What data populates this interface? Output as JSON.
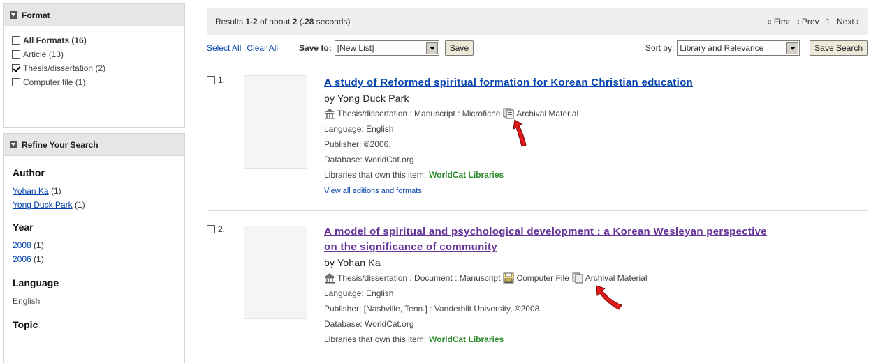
{
  "format_panel": {
    "title": "Format",
    "items": [
      {
        "label": "All Formats",
        "count": "(16)",
        "checked": false
      },
      {
        "label": "Article",
        "count": "(13)",
        "checked": false
      },
      {
        "label": "Thesis/dissertation",
        "count": "(2)",
        "checked": true
      },
      {
        "label": "Computer file",
        "count": "(1)",
        "checked": false
      }
    ]
  },
  "refine_panel": {
    "title": "Refine Your Search",
    "author": {
      "heading": "Author",
      "items": [
        {
          "label": "Yohan Ka",
          "count": "(1)"
        },
        {
          "label": "Yong Duck Park",
          "count": "(1)"
        }
      ]
    },
    "year": {
      "heading": "Year",
      "items": [
        {
          "label": "2008",
          "count": "(1)"
        },
        {
          "label": "2006",
          "count": "(1)"
        }
      ]
    },
    "language": {
      "heading": "Language",
      "value": "English"
    },
    "topic": {
      "heading": "Topic"
    }
  },
  "results_bar": {
    "prefix": "Results ",
    "range": "1-2",
    "middle": " of about ",
    "total": "2",
    "time_open": " (",
    "time": ".28",
    "time_close": " seconds)",
    "first": "« First",
    "prev": "‹ Prev",
    "page": "1",
    "next": "Next ›"
  },
  "toolbar": {
    "select_all": "Select All",
    "clear_all": "Clear All",
    "save_to_label": "Save to:",
    "save_to_value": "[New List]",
    "save_button": "Save",
    "sort_label": "Sort by:",
    "sort_value": "Library and Relevance",
    "save_search_button": "Save Search"
  },
  "results": [
    {
      "number": "1.",
      "title": "A study of Reformed spiritual formation for Korean Christian education",
      "author": "by Yong Duck Park",
      "format_text": "Thesis/dissertation : Manuscript : Microfiche",
      "format_extra": "Archival Material",
      "language": "Language: English",
      "publisher": "Publisher: ©2006.",
      "database": "Database: WorldCat.org",
      "libraries_label": "Libraries that own this item:",
      "libraries_link": "WorldCat Libraries",
      "view_all": "View all editions and formats"
    },
    {
      "number": "2.",
      "title_line1": "A model of spiritual and psychological development : a Korean Wesleyan perspective",
      "title_line2": "on the significance of community",
      "author": "by Yohan Ka",
      "format_text": "Thesis/dissertation : Document : Manuscript",
      "format_computer": "Computer File",
      "format_extra": "Archival Material",
      "language": "Language: English",
      "publisher": "Publisher: [Nashville, Tenn.] : Vanderbilt University, ©2008.",
      "database": "Database: WorldCat.org",
      "libraries_label": "Libraries that own this item:",
      "libraries_link": "WorldCat Libraries"
    }
  ],
  "colors": {
    "link": "#0645ad",
    "visited_link": "#663399",
    "green": "#2e8b2e",
    "annotation_arrow": "#e01b1b"
  },
  "icons": [
    "collapse-triangle-icon",
    "checkbox-icon",
    "thesis-building-icon",
    "archival-material-icon",
    "computer-file-icon",
    "red-pointer-arrow-icon"
  ]
}
